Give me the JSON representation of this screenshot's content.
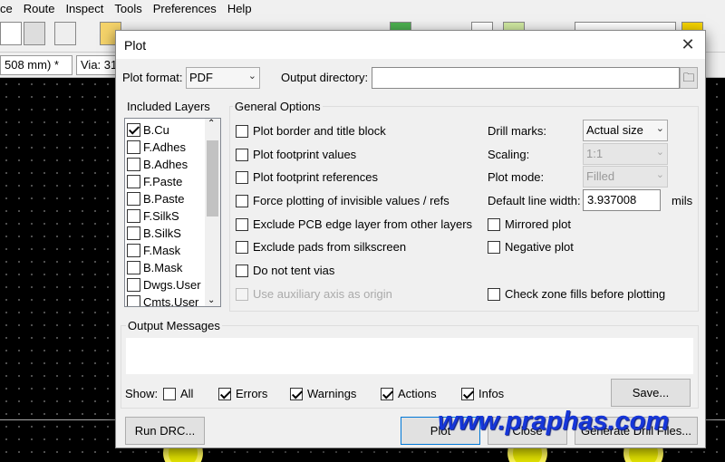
{
  "app": {
    "menu": [
      "ce",
      "Route",
      "Inspect",
      "Tools",
      "Preferences",
      "Help"
    ],
    "toolbar2": {
      "track_width": "508 mm) *",
      "via": "Via: 31"
    }
  },
  "dialog": {
    "title": "Plot",
    "close_symbol": "✕",
    "plot_format_label": "Plot format:",
    "plot_format_value": "PDF",
    "output_dir_label": "Output directory:",
    "output_dir_value": "",
    "included_layers_title": "Included Layers",
    "layers": [
      {
        "name": "B.Cu",
        "checked": true
      },
      {
        "name": "F.Adhes",
        "checked": false
      },
      {
        "name": "B.Adhes",
        "checked": false
      },
      {
        "name": "F.Paste",
        "checked": false
      },
      {
        "name": "B.Paste",
        "checked": false
      },
      {
        "name": "F.SilkS",
        "checked": false
      },
      {
        "name": "B.SilkS",
        "checked": false
      },
      {
        "name": "F.Mask",
        "checked": false
      },
      {
        "name": "B.Mask",
        "checked": false
      },
      {
        "name": "Dwgs.User",
        "checked": false
      },
      {
        "name": "Cmts.User",
        "checked": false
      }
    ],
    "general_options_title": "General Options",
    "options_left": [
      {
        "label": "Plot border and title block",
        "checked": false,
        "enabled": true
      },
      {
        "label": "Plot footprint values",
        "checked": false,
        "enabled": true
      },
      {
        "label": "Plot footprint references",
        "checked": false,
        "enabled": true
      },
      {
        "label": "Force plotting of invisible values / refs",
        "checked": false,
        "enabled": true
      },
      {
        "label": "Exclude PCB edge layer from other layers",
        "checked": false,
        "enabled": true
      },
      {
        "label": "Exclude pads from silkscreen",
        "checked": false,
        "enabled": true
      },
      {
        "label": "Do not tent vias",
        "checked": false,
        "enabled": true
      },
      {
        "label": "Use auxiliary axis as origin",
        "checked": false,
        "enabled": false
      }
    ],
    "drill_marks_label": "Drill marks:",
    "drill_marks_value": "Actual size",
    "scaling_label": "Scaling:",
    "scaling_value": "1:1",
    "plot_mode_label": "Plot mode:",
    "plot_mode_value": "Filled",
    "line_width_label": "Default line width:",
    "line_width_value": "3.937008",
    "line_width_unit": "mils",
    "mirrored_label": "Mirrored plot",
    "mirrored_checked": false,
    "negative_label": "Negative plot",
    "negative_checked": false,
    "zone_fills_label": "Check zone fills before plotting",
    "zone_fills_checked": false,
    "output_messages_title": "Output Messages",
    "show_label": "Show:",
    "filters": [
      {
        "label": "All",
        "checked": false
      },
      {
        "label": "Errors",
        "checked": true
      },
      {
        "label": "Warnings",
        "checked": true
      },
      {
        "label": "Actions",
        "checked": true
      },
      {
        "label": "Infos",
        "checked": true
      }
    ],
    "save_button": "Save...",
    "run_drc_button": "Run DRC...",
    "plot_button": "Plot",
    "close_button": "Close",
    "drill_files_button": "Generate Drill Files..."
  },
  "watermark": "www.praphas.com"
}
